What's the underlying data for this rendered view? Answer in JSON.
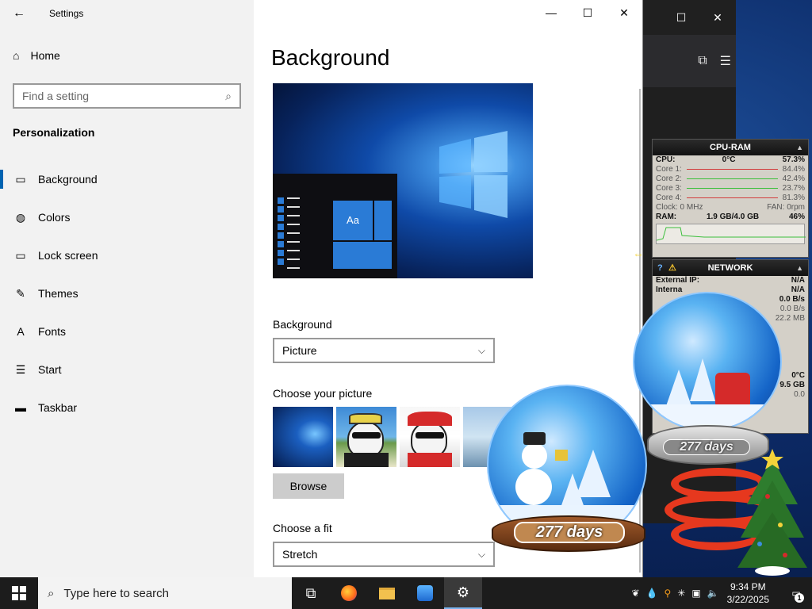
{
  "window": {
    "title": "Settings",
    "minimize": "—",
    "maximize": "☐",
    "close": "✕"
  },
  "sidebar": {
    "home_label": "Home",
    "search_placeholder": "Find a setting",
    "section_title": "Personalization",
    "items": [
      {
        "label": "Background",
        "icon": "image-icon",
        "glyph": "▭"
      },
      {
        "label": "Colors",
        "icon": "palette-icon",
        "glyph": "◍"
      },
      {
        "label": "Lock screen",
        "icon": "lock-screen-icon",
        "glyph": "▭"
      },
      {
        "label": "Themes",
        "icon": "themes-icon",
        "glyph": "✎"
      },
      {
        "label": "Fonts",
        "icon": "fonts-icon",
        "glyph": "A"
      },
      {
        "label": "Start",
        "icon": "start-icon",
        "glyph": "☰"
      },
      {
        "label": "Taskbar",
        "icon": "taskbar-icon",
        "glyph": "▬"
      }
    ]
  },
  "main": {
    "title": "Background",
    "preview_tile_text": "Aa",
    "background_label": "Background",
    "background_value": "Picture",
    "choose_picture_label": "Choose your picture",
    "browse_label": "Browse",
    "choose_fit_label": "Choose a fit",
    "fit_value": "Stretch"
  },
  "cpu_widget": {
    "title": "CPU-RAM",
    "cpu_label": "CPU:",
    "cpu_temp": "0°C",
    "cpu_value": "57.3%",
    "cores": [
      {
        "label": "Core 1:",
        "value": "84.4%",
        "color": "#d23c3c"
      },
      {
        "label": "Core 2:",
        "value": "42.4%",
        "color": "#3cbf3c"
      },
      {
        "label": "Core 3:",
        "value": "23.7%",
        "color": "#3cbf3c"
      },
      {
        "label": "Core 4:",
        "value": "81.3%",
        "color": "#d23c3c"
      }
    ],
    "clock_label": "Clock: 0 MHz",
    "fan_label": "FAN: 0rpm",
    "ram_label": "RAM:",
    "ram_used": "1.9 GB/4.0 GB",
    "ram_value": "46%"
  },
  "network_widget": {
    "title": "NETWORK",
    "external_ip_label": "External IP:",
    "external_ip_value": "N/A",
    "internal_label": "Interna",
    "internal_value": "N/A",
    "row3_value": "0.0 B/s",
    "row4_value": "0.0 B/s",
    "row5_value": "22.2 MB",
    "temp_value": "0°C",
    "size_value": "9.5 GB",
    "small_value": "0.0"
  },
  "snow_globes": {
    "badge_text": "277 days"
  },
  "taskbar": {
    "search_placeholder": "Type here to search",
    "time": "9:34 PM",
    "date": "3/22/2025",
    "notification_count": "1"
  },
  "colors": {
    "accent": "#0063b1",
    "sidebar_bg": "#f2f2f2",
    "taskbar_bg": "#1c1c1c"
  }
}
